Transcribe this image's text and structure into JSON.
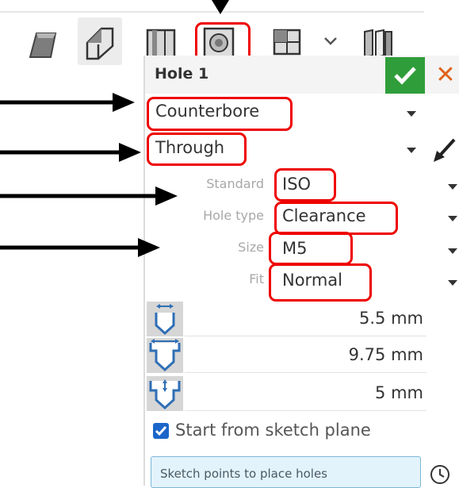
{
  "toolbar": {
    "icons": [
      "extrude-icon",
      "revolve-icon",
      "fillet-icon",
      "hole-icon",
      "pattern-icon",
      "dropdown-icon",
      "mirror-icon"
    ]
  },
  "dialog": {
    "title": "Hole 1",
    "hole_style": "Counterbore",
    "termination": "Through",
    "standard_label": "Standard",
    "standard_value": "ISO",
    "hole_type_label": "Hole type",
    "hole_type_value": "Clearance",
    "size_label": "Size",
    "size_value": "M5",
    "fit_label": "Fit",
    "fit_value": "Normal",
    "dimensions": [
      {
        "icon": "hole-diameter-icon",
        "value": "5.5 mm"
      },
      {
        "icon": "counterbore-diameter-icon",
        "value": "9.75 mm"
      },
      {
        "icon": "counterbore-depth-icon",
        "value": "5 mm"
      }
    ],
    "start_from_sketch_plane": "Start from sketch plane",
    "hint": "Sketch points to place holes"
  },
  "colors": {
    "annotation": "#ee0000",
    "ok": "#2f9e3a",
    "close": "#e0621b",
    "checkbox": "#1b66c9"
  }
}
